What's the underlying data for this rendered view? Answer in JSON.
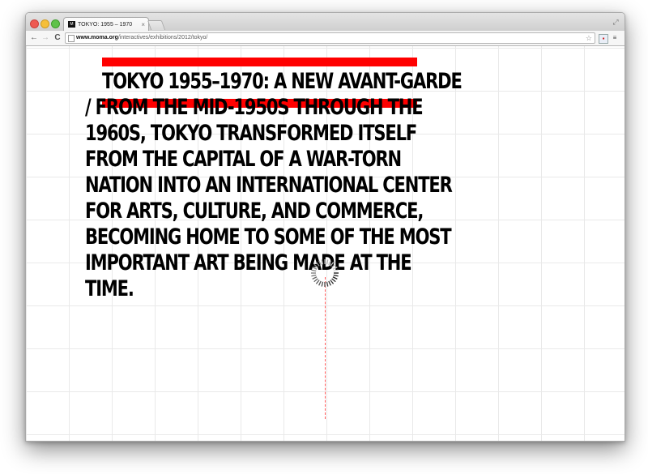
{
  "browser": {
    "tab_title": "TOKYO: 1955 – 1970",
    "tab_close": "×",
    "url_host": "www.moma.org",
    "url_path": "/interactives/exhibitions/2012/tokyo/"
  },
  "page": {
    "headline": "TOKYO 1955–1970: A NEW AVANT-GARDE / FROM THE MID-1950S THROUGH THE 1960S, TOKYO TRANSFORMED ITSELF FROM THE CAPITAL OF A WAR-TORN NATION INTO AN INTERNATIONAL CENTER FOR ARTS, CULTURE, AND COMMERCE, BECOMING HOME TO SOME OF THE MOST IMPORTANT ART BEING MADE AT THE TIME.",
    "accent_color": "#ff0000",
    "loading_indicator": "spinner"
  }
}
